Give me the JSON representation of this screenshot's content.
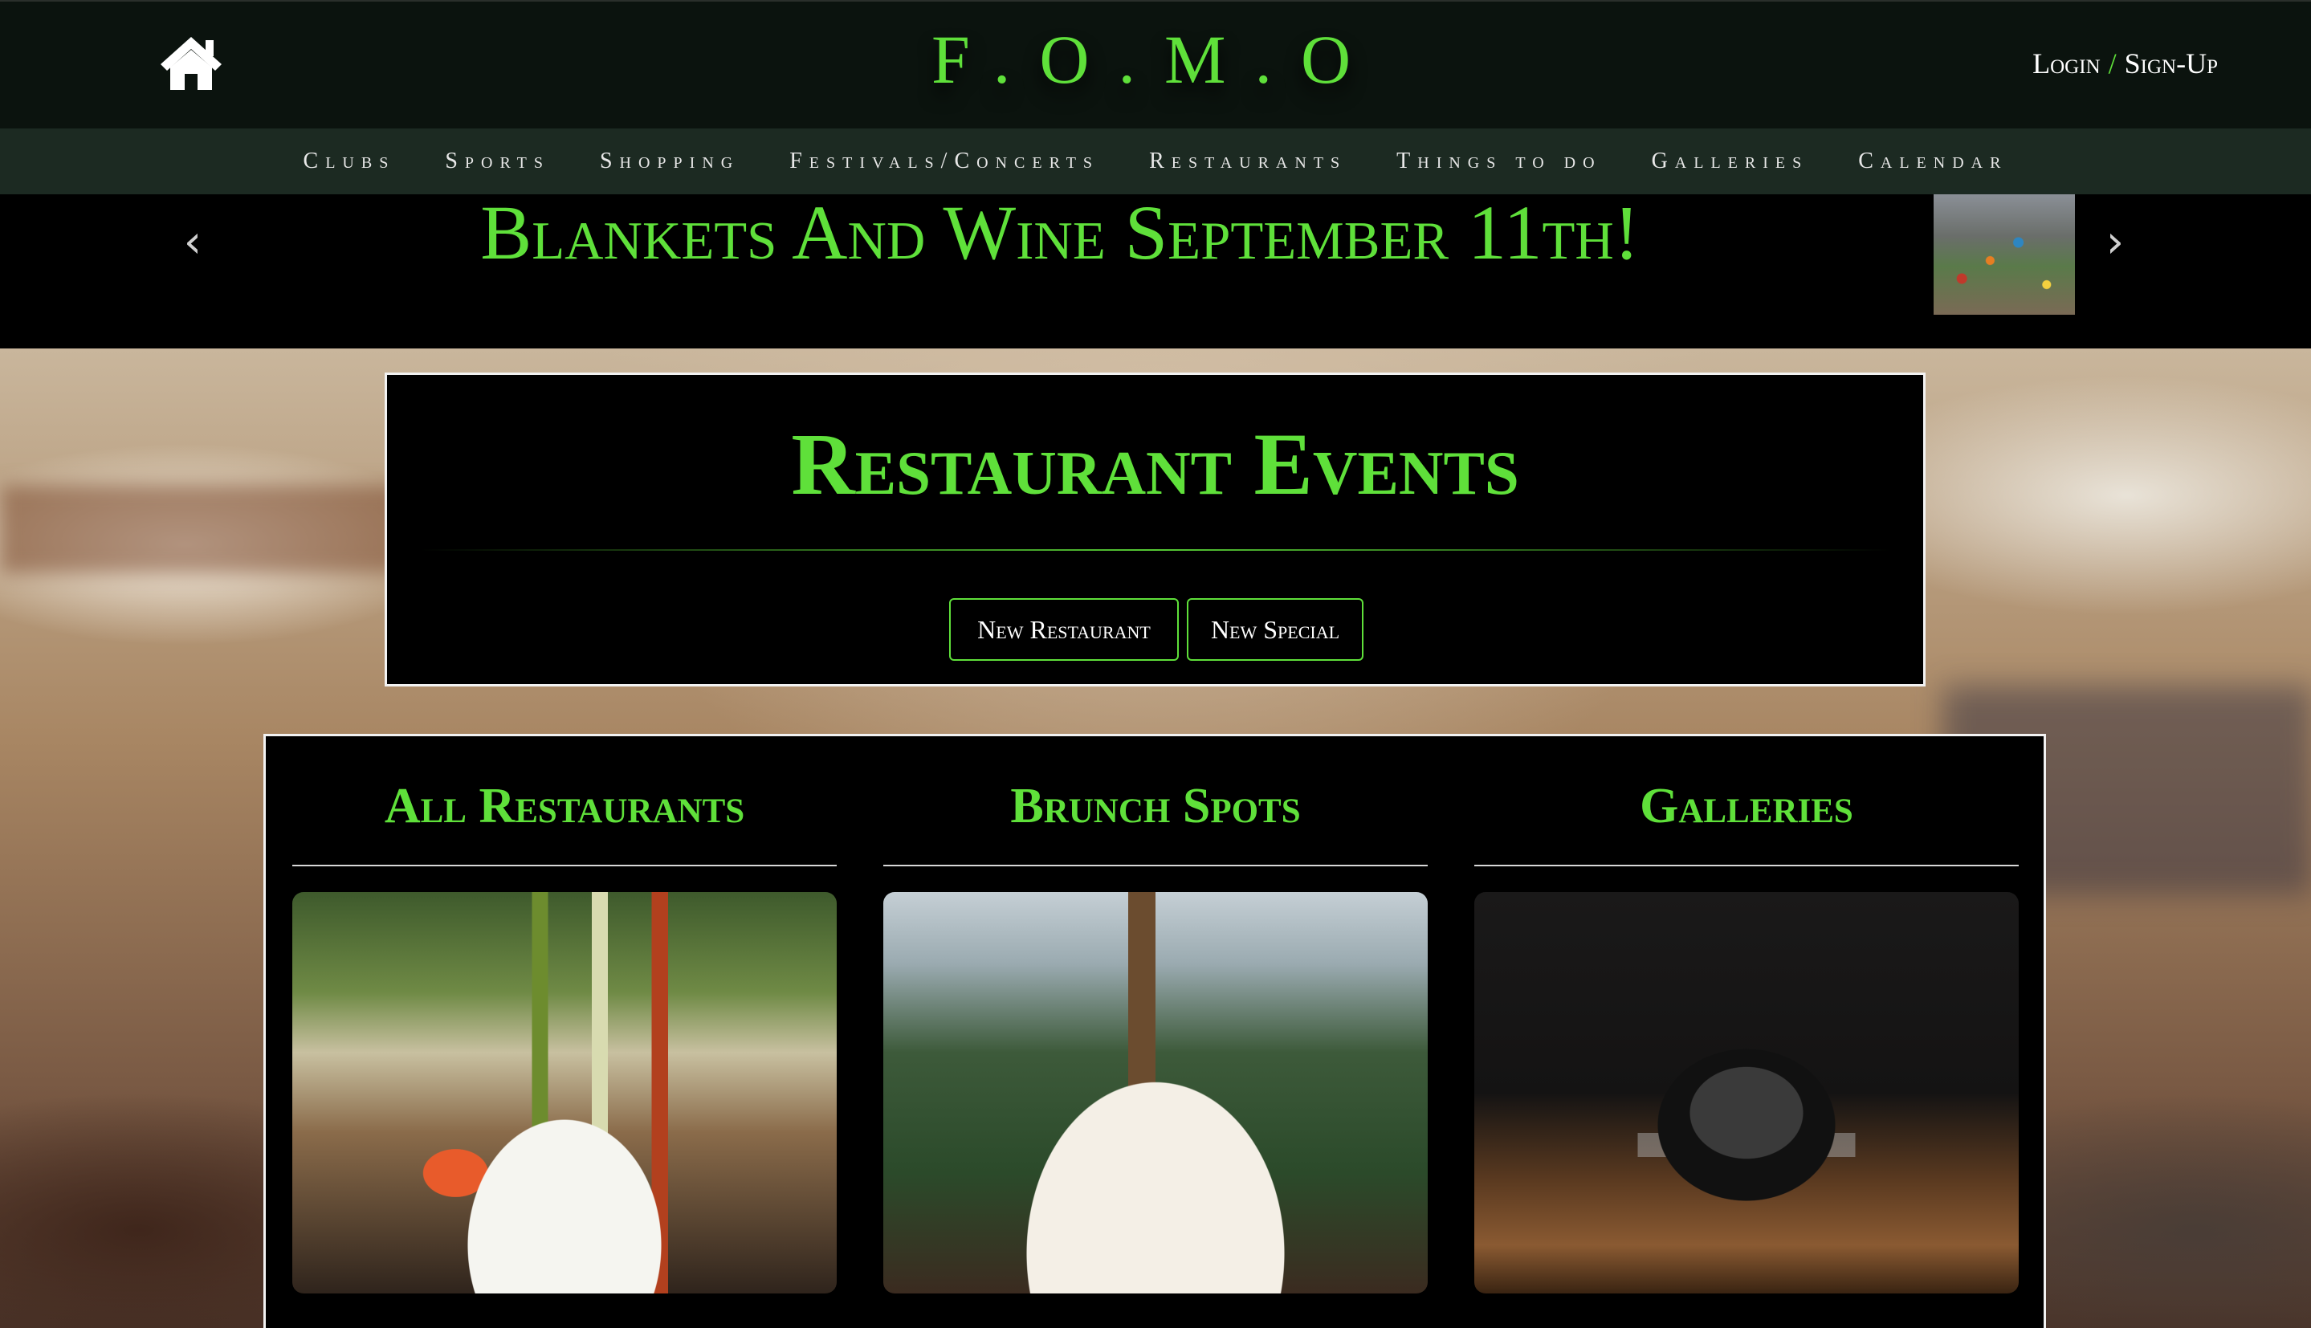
{
  "header": {
    "brand": "F.O.M.O",
    "auth": {
      "login": "Login",
      "separator": "/",
      "signup": "Sign-Up"
    },
    "icons": {
      "home": "home-icon"
    }
  },
  "nav": {
    "items": [
      {
        "label": "Clubs"
      },
      {
        "label": "Sports"
      },
      {
        "label": "Shopping"
      },
      {
        "label": "Festivals/Concerts"
      },
      {
        "label": "Restaurants"
      },
      {
        "label": "Things to do"
      },
      {
        "label": "Galleries"
      },
      {
        "label": "Calendar"
      }
    ]
  },
  "carousel": {
    "headline": "Blankets And Wine September 11th!",
    "prev_icon": "chevron-left-icon",
    "next_icon": "chevron-right-icon"
  },
  "events": {
    "title": "Restaurant Events",
    "buttons": {
      "new_restaurant": "New Restaurant",
      "new_special": "New Special"
    }
  },
  "categories": [
    {
      "title": "All Restaurants"
    },
    {
      "title": "Brunch Spots"
    },
    {
      "title": "Galleries"
    }
  ],
  "colors": {
    "accent": "#5fe03a",
    "header_bg": "#0b130e",
    "nav_bg": "#1c2a22",
    "panel_bg": "#000000",
    "panel_border": "#f2f2f2"
  }
}
